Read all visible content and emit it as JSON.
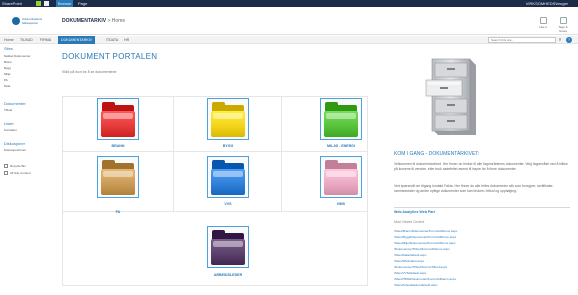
{
  "suite_bar": {
    "brand": "SharePoint",
    "tabs": [
      "Browse",
      "Page"
    ],
    "user": "VIRKSOMHEDS\\bruger"
  },
  "header": {
    "logo_line1": "virksomhedens",
    "logo_line2": "fællesportal",
    "site_title": "DOKUMENTARKIV",
    "breadcrumb": "Home",
    "ribbon": [
      "Like it",
      "Tags & Notes"
    ]
  },
  "top_nav": {
    "items": [
      "Home",
      "TILBUD",
      "FIRMA",
      "DOKUMENTARKIV",
      "ITDATA",
      "HR"
    ],
    "active_index": 3,
    "search_placeholder": "Search this site..."
  },
  "left_nav": {
    "groups": [
      {
        "heading": "Sites",
        "items": [
          "Nøkkel Dokumenter",
          "Brann",
          "Bygg",
          "Miljø",
          "PA",
          "Data"
        ]
      },
      {
        "heading": "Dokumenter",
        "items": [
          "Tilbud"
        ]
      },
      {
        "heading": "Lister",
        "items": [
          "Kontakter"
        ]
      },
      {
        "heading": "Diskusjoner",
        "items": [
          "Diskusjonsforum"
        ]
      }
    ],
    "footer": [
      "Recycle Bin",
      "All Site Content"
    ]
  },
  "main": {
    "title": "DOKUMENT PORTALEN",
    "sublink": "Klikk på ikon for å se dokumentene",
    "folders": [
      {
        "label": "BRANN",
        "color": "#e53a3a"
      },
      {
        "label": "BYGG",
        "color": "#f2d21b"
      },
      {
        "label": "MILJØ - ENERGI",
        "color": "#58c13b"
      },
      {
        "label": "PA",
        "color": "#c99a55"
      },
      {
        "label": "VVS",
        "color": "#2f7fd8"
      },
      {
        "label": "HMS",
        "color": "#e9a7c0"
      },
      {
        "label": "ARBEIDSLEDER",
        "color": "#5a3f6b"
      }
    ]
  },
  "right": {
    "title": "KOM I GANG - DOKUMENTARKIVET:",
    "para1": "Velkommen til dokumentarkivet. Her finner du lenker til alle fagområdenes dokumenter. Velg fagområde ved å klikke på ikonene til venstre, eller bruk søkefeltet øverst til høyre for å finne dokumenter.",
    "para2": "Ved spørsmål om tilgang kontakt Fakta. Her finner du alle felles dokumenter slik som brosjyrer, sertifikater, rammeavtaler og andre nyttige dokumenter som kan brukes i tilbud og oppfølging.",
    "webpart_title": "Web Analytics Web Part",
    "webpart_sub": "Most Viewed Content",
    "links": [
      "/Sites/Brann/Dokumenter/Forms/AllItems.aspx",
      "/Sites/Bygg/Dokumenter/Forms/AllItems.aspx",
      "/Sites/Miljo/Dokumenter/Forms/AllItems.aspx",
      "/Dokumenter/Tilbud/Forms/AllItems.aspx",
      "/Sites/Data/default.aspx",
      "/Sites/PA/default.aspx",
      "/Dokumenter/Tilbud/Forms/Tilbud.aspx",
      "/Sites/VVS/default.aspx",
      "/Sites/HMS/Dokumenter/Forms/AllItems.aspx",
      "/Sites/Arbeidsleder/default.aspx"
    ]
  },
  "colors": {
    "accent": "#2a7ab8",
    "suite_bar": "#1b2b48"
  }
}
